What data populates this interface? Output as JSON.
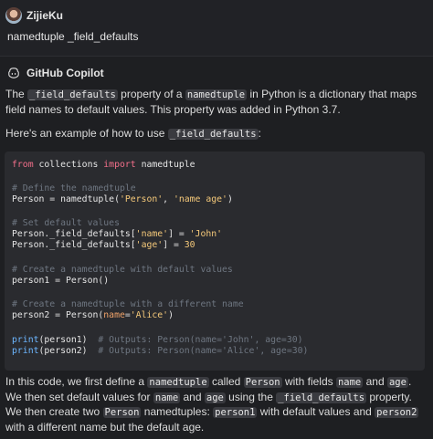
{
  "user_message": {
    "username": "ZijieKu",
    "text": "namedtuple _field_defaults"
  },
  "copilot": {
    "name": "GitHub Copilot",
    "p1": {
      "t1": "The ",
      "c1": "_field_defaults",
      "t2": " property of a ",
      "c2": "namedtuple",
      "t3": " in Python is a dictionary that maps field names to default values. This property was added in Python 3.7."
    },
    "p2": {
      "t1": "Here's an example of how to use ",
      "c1": "_field_defaults",
      "t2": ":"
    },
    "code": {
      "l1": {
        "a": "from",
        "b": " collections ",
        "c": "import",
        "d": " namedtuple"
      },
      "l2": "# Define the namedtuple",
      "l3": {
        "a": "Person = namedtuple(",
        "b": "'Person'",
        "c": ", ",
        "d": "'name age'",
        "e": ")"
      },
      "l4": "# Set default values",
      "l5": {
        "a": "Person._field_defaults[",
        "b": "'name'",
        "c": "] = ",
        "d": "'John'"
      },
      "l6": {
        "a": "Person._field_defaults[",
        "b": "'age'",
        "c": "] = ",
        "d": "30"
      },
      "l7": "# Create a namedtuple with default values",
      "l8": "person1 = Person()",
      "l9": "# Create a namedtuple with a different name",
      "l10": {
        "a": "person2 = Person(",
        "b": "name",
        "c": "=",
        "d": "'Alice'",
        "e": ")"
      },
      "l11": {
        "a": "print",
        "b": "(person1)  ",
        "c": "# Outputs: Person(name='John', age=30)"
      },
      "l12": {
        "a": "print",
        "b": "(person2)  ",
        "c": "# Outputs: Person(name='Alice', age=30)"
      }
    },
    "p3": {
      "t1": "In this code, we first define a ",
      "c1": "namedtuple",
      "t2": " called ",
      "c2": "Person",
      "t3": " with fields ",
      "c3": "name",
      "t4": " and ",
      "c4": "age",
      "t5": ". We then set default values for ",
      "c5": "name",
      "t6": " and ",
      "c6": "age",
      "t7": " using the ",
      "c7": "_field_defaults",
      "t8": " property. We then create two ",
      "c8": "Person",
      "t9": " namedtuples: ",
      "c9": "person1",
      "t10": " with default values and ",
      "c10": "person2",
      "t11": " with a different name but the default age."
    }
  },
  "colors": {
    "background": "#1e1f22",
    "code_background": "#2a2b2f",
    "keyword": "#f26f8a",
    "string": "#f5c97a",
    "comment": "#6e7681",
    "function": "#6cb6ff"
  },
  "icons": {
    "user_avatar": "avatar",
    "copilot": "copilot-icon"
  }
}
